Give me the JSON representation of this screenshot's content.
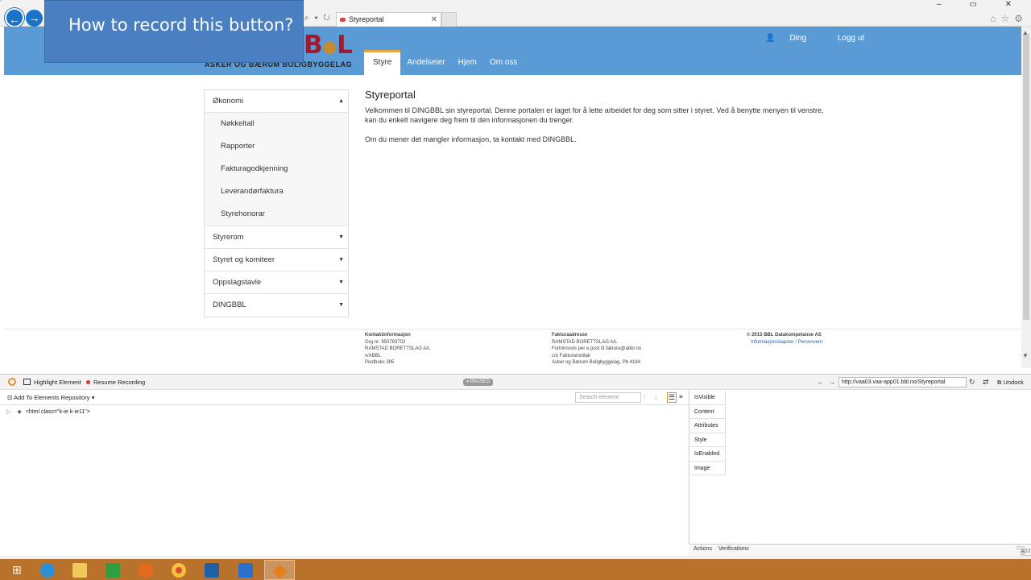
{
  "callout": {
    "text": "How to record this button?"
  },
  "browser": {
    "tab_title": "Styreportal",
    "tab_close": "✕",
    "window_controls": "– ▭ ✕",
    "icons": [
      "home-icon",
      "star-icon",
      "gear-icon"
    ],
    "address_tools": "⌕ ▾ ↻"
  },
  "site": {
    "logo_mark": "B",
    "logo_mark_tail": "L",
    "logo_text": "ASKER OG BÆRUM BOLIGBYGGELAG",
    "nav": [
      "Styre",
      "Andelseier",
      "Hjem",
      "Om oss"
    ],
    "user_name": "Ding",
    "logout": "Logg ut"
  },
  "menu": {
    "sections": [
      {
        "label": "Økonomi",
        "arrow": "▲",
        "open": true,
        "items": [
          "Nøkkeltall",
          "Rapporter",
          "Fakturagodkjenning",
          "Leverandørfaktura",
          "Styrehonorar"
        ]
      },
      {
        "label": "Styrerom",
        "arrow": "▼"
      },
      {
        "label": "Styret og komiteer",
        "arrow": "▼"
      },
      {
        "label": "Oppslagstavle",
        "arrow": "▼"
      },
      {
        "label": "DINGBBL",
        "arrow": "▼"
      }
    ]
  },
  "content": {
    "title": "Styreportal",
    "paragraph1": "Velkommen til DINGBBL sin styreportal. Denne portalen er laget for å lette arbeidet for deg som sitter i styret. Ved å benytte menyen til venstre, kan du enkelt navigere deg frem til den informasjonen du trenger.",
    "paragraph2": "Om du mener det mangler informasjon, ta kontakt med DINGBBL."
  },
  "footer": {
    "contact": {
      "heading": "Kontaktinformasjon",
      "lines": [
        "Org.nr: 950783702",
        "RAMSTAD BORETTSLAG A/L",
        "v/ABBL",
        "Postboks 385"
      ]
    },
    "invoice": {
      "heading": "Fakturaadresse",
      "lines": [
        "RAMSTAD BORETTSLAG A/L",
        "Fortrinnsvis per e post til faktura@abbl.no",
        "c/o Fakturamottak",
        "Asker og Bærum Boligbyggelag, Pb 4184"
      ]
    },
    "copyright": {
      "heading": "© 2015 BBL Datakompetanse AS",
      "link": "Informasjonskapsler / Personvern"
    }
  },
  "recorder": {
    "highlight": "Highlight Element",
    "resume": "Resume Recording",
    "paused": "PAUSED",
    "url": "http://vaa03.vaa-app01.bbl.no/Styreportal",
    "undock": "Undock",
    "add_repo": "Add To Elements Repository",
    "search_placeholder": "Search element",
    "tree_root": "<html class=\"k-ie k-ie11\">",
    "prop_tabs": [
      "IsVisible",
      "Content",
      "Attributes",
      "Style",
      "IsEnabled",
      "Image"
    ],
    "bottom_tabs": [
      "Actions",
      "Verifications"
    ],
    "add_step": "Add Step"
  },
  "taskbar": {
    "apps": [
      "windows-start",
      "internet-explorer",
      "file-explorer",
      "store",
      "firefox",
      "chrome",
      "outlook",
      "lync",
      "test-studio"
    ]
  }
}
